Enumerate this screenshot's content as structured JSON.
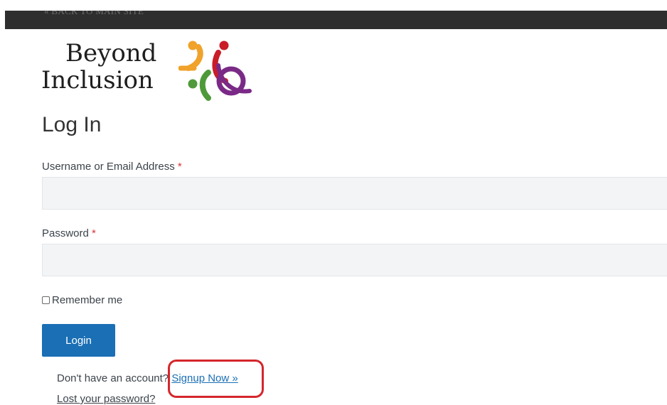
{
  "topbar": {
    "back_link": "« BACK TO MAIN SITE"
  },
  "logo": {
    "line1": "Beyond",
    "line2": "Inclusion"
  },
  "form": {
    "heading": "Log In",
    "username_label": "Username or Email Address",
    "required_mark": "*",
    "username_value": "",
    "password_label": "Password",
    "password_value": "",
    "remember_label": "Remember me",
    "remember_checked": false,
    "login_button": "Login",
    "signup_prompt": "Don't have an account?",
    "signup_link": "Signup Now »",
    "lost_password_link": "Lost your password?"
  },
  "colors": {
    "topbar": "#2e2e2e",
    "button": "#1a6fb5",
    "link": "#1a6fb5",
    "required": "#d63638",
    "highlight": "#d4262c",
    "logo_orange": "#f0a22a",
    "logo_red": "#c91d28",
    "logo_green": "#4e9a3a",
    "logo_purple": "#7a2a86"
  }
}
